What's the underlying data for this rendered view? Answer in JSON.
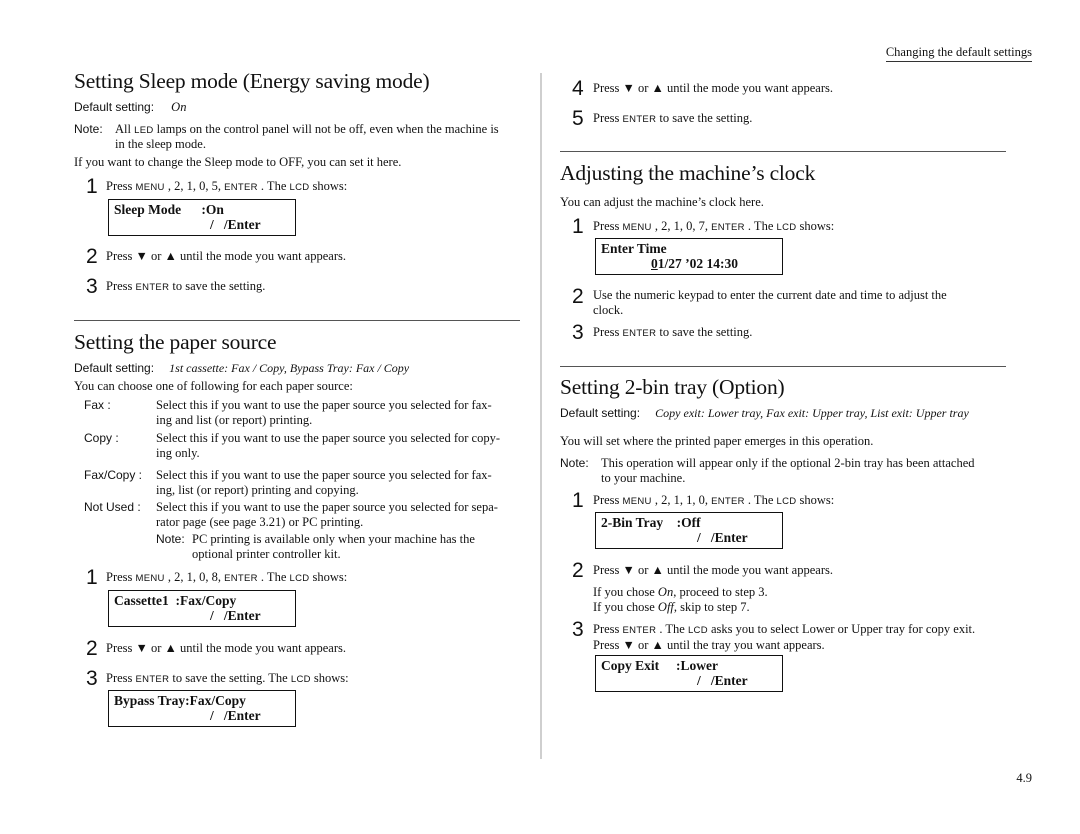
{
  "header": {
    "running_title": "Changing the default settings"
  },
  "page_number": "4.9",
  "left_column": {
    "sleep_mode": {
      "title": "Setting Sleep mode (Energy saving mode)",
      "default_label": "Default setting:",
      "default_value": "On",
      "note_label": "Note:",
      "note_line1_pre": "All ",
      "note_line1_sc": "LED",
      "note_line1_post": " lamps on the control panel will not be off, even when the machine is",
      "note_line2": "in the sleep mode.",
      "intro": "If you want to change the Sleep mode to OFF, you can set it here.",
      "steps": [
        {
          "num": "1",
          "pre": "Press ",
          "key1": "MENU",
          "mid": " , 2, 1, 0, 5, ",
          "key2": "ENTER",
          "post1": " . The ",
          "key3": "LCD",
          "post2": " shows:"
        },
        {
          "num": "2",
          "text": "Press ▼ or ▲ until the mode you want appears."
        },
        {
          "num": "3",
          "pre": "Press ",
          "key": "ENTER",
          "post": "  to save the setting."
        }
      ],
      "lcd": {
        "line1": "Sleep Mode      :On",
        "line2": "/   /Enter"
      }
    },
    "paper_source": {
      "title": "Setting the paper source",
      "default_label": "Default setting:",
      "default_value": "1st cassette: Fax / Copy,  Bypass Tray: Fax / Copy",
      "intro": "You can choose one of following for each paper source:",
      "options": [
        {
          "term": "Fax :",
          "line1": "Select this if you want to use the paper source you selected for fax-",
          "line2": "ing and list (or report) printing."
        },
        {
          "term": "Copy :",
          "line1": "Select this if you want to use the paper source you selected for copy-",
          "line2": "ing only."
        },
        {
          "term": "Fax/Copy :",
          "line1": "Select this if you want to use the paper source you selected for fax-",
          "line2": "ing, list (or report) printing and copying."
        },
        {
          "term": "Not Used :",
          "line1": "Select this if you want to use the paper source you selected for sepa-",
          "line2": "rator page (see page 3.21) or PC printing."
        }
      ],
      "sub_note_label": "Note:",
      "sub_note_line1": "PC printing is available only when your machine has the",
      "sub_note_line2": "optional printer controller kit.",
      "steps": [
        {
          "num": "1",
          "pre": "Press ",
          "key1": "MENU",
          "mid": " , 2, 1, 0, 8, ",
          "key2": "ENTER",
          "post1": " . The ",
          "key3": "LCD",
          "post2": " shows:"
        },
        {
          "num": "2",
          "text": "Press ▼ or ▲ until the mode you want appears."
        },
        {
          "num": "3",
          "pre": "Press ",
          "key": "ENTER",
          "post": "  to save the setting. The ",
          "key2": "LCD",
          "post2": " shows:"
        }
      ],
      "lcd1": {
        "line1": "Cassette1  :Fax/Copy",
        "line2": "/   /Enter"
      },
      "lcd2": {
        "line1": "Bypass Tray:Fax/Copy",
        "line2": "/   /Enter"
      }
    }
  },
  "right_column": {
    "sleep_cont_steps": [
      {
        "num": "4",
        "text": "Press ▼ or ▲ until the mode you want appears."
      },
      {
        "num": "5",
        "pre": "Press ",
        "key": "ENTER",
        "post": "  to save the setting."
      }
    ],
    "clock": {
      "title": "Adjusting the machine’s clock",
      "intro": "You can adjust the machine’s clock here.",
      "steps": [
        {
          "num": "1",
          "pre": "Press ",
          "key1": "MENU",
          "mid": " , 2, 1, 0, 7, ",
          "key2": "ENTER",
          "post1": " . The ",
          "key3": "LCD",
          "post2": " shows:"
        },
        {
          "num": "2",
          "line1": "Use the numeric keypad to enter the current date and time to adjust the",
          "line2": "clock."
        },
        {
          "num": "3",
          "pre": "Press ",
          "key": "ENTER",
          "post": "  to save the setting."
        }
      ],
      "lcd": {
        "line1": "Enter Time",
        "line2_cursor": "0",
        "line2_rest": "1/27 ’02 14:30"
      }
    },
    "bin_tray": {
      "title": "Setting 2-bin tray (Option)",
      "default_label": "Default setting:",
      "default_value": "Copy exit: Lower tray, Fax exit: Upper tray, List exit: Upper tray",
      "intro": "You will set where the printed paper emerges in this operation.",
      "note_label": "Note:",
      "note_line1": "This operation will appear only if the optional 2-bin tray has been attached",
      "note_line2": "to your machine.",
      "steps": [
        {
          "num": "1",
          "pre": "Press ",
          "key1": "MENU",
          "mid": " , 2, 1, 1, 0, ",
          "key2": "ENTER",
          "post1": " . The ",
          "key3": "LCD",
          "post2": " shows:"
        },
        {
          "num": "2",
          "text": "Press ▼ or ▲ until the mode you want appears.",
          "sub1_pre": "If you chose ",
          "sub1_em": "On",
          "sub1_post": ", proceed to step 3.",
          "sub2_pre": "If you chose ",
          "sub2_em": "Off",
          "sub2_post": ", skip to step 7."
        },
        {
          "num": "3",
          "pre": "Press ",
          "key": "ENTER",
          "mid": " . The ",
          "key2": "LCD",
          "post": " asks you to select Lower or Upper tray for copy exit.",
          "line2": "Press ▼ or ▲ until the tray you want appears."
        }
      ],
      "lcd1": {
        "line1": "2-Bin Tray    :Off",
        "line2": "/   /Enter"
      },
      "lcd2": {
        "line1": "Copy Exit     :Lower",
        "line2": "/   /Enter"
      }
    }
  }
}
